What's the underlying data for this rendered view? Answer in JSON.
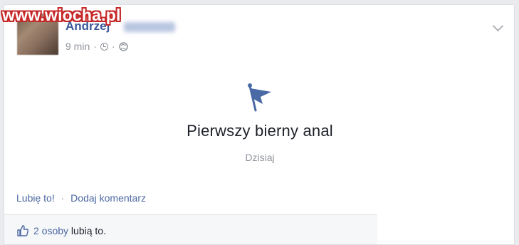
{
  "watermark": "www.wiocha.pl",
  "post": {
    "author": "Andrzej",
    "time": "9 min",
    "meta_sep": "·",
    "menu_icon": "chevron-down-icon"
  },
  "life_event": {
    "icon": "flag-icon",
    "title": "Pierwszy bierny anal",
    "date": "Dzisiaj"
  },
  "actions": {
    "like_label": "Lubię to!",
    "separator": "·",
    "comment_label": "Dodaj komentarz"
  },
  "likes": {
    "icon": "thumbs-up-icon",
    "count_text": "2 osoby",
    "suffix": " lubią to."
  },
  "colors": {
    "brand_link": "#4b67a1",
    "flag": "#4a6aa5"
  }
}
